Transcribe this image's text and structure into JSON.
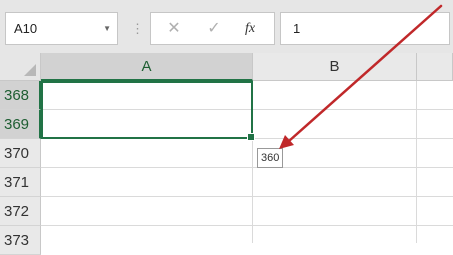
{
  "formula_bar": {
    "name_box": "A10",
    "cancel_icon": "✕",
    "enter_icon": "✓",
    "fx_label": "fx",
    "formula_value": "1"
  },
  "grid": {
    "columns": [
      "A",
      "B"
    ],
    "rows": [
      "368",
      "369",
      "370",
      "371",
      "372",
      "373"
    ],
    "selected_column": "A",
    "selected_rows": [
      "368",
      "369"
    ]
  },
  "tooltip": {
    "text": "360"
  },
  "colors": {
    "selection": "#217346",
    "arrow": "#c0282a"
  }
}
